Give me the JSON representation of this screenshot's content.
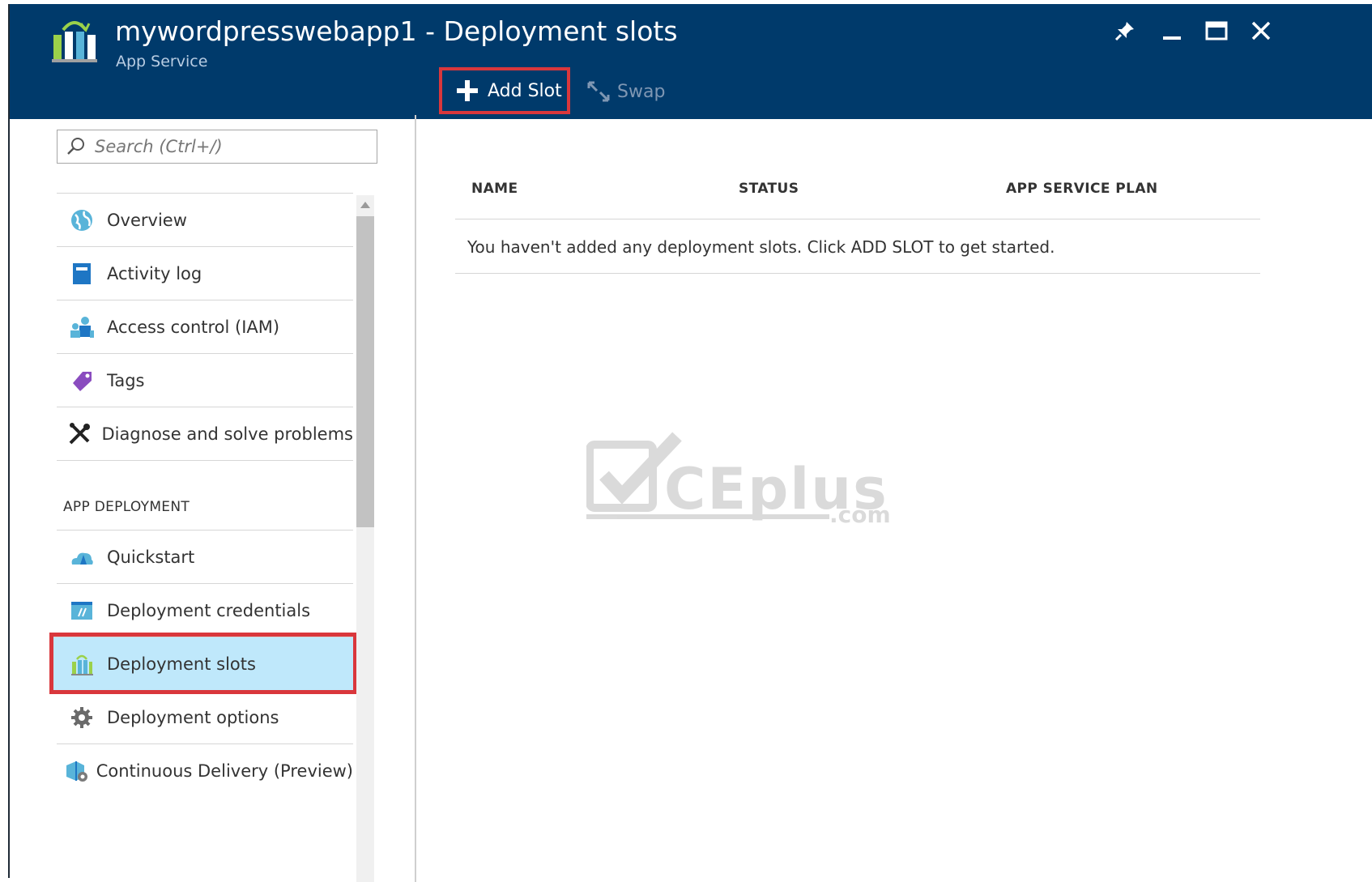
{
  "header": {
    "title": "mywordpresswebapp1 - Deployment slots",
    "subtitle": "App Service",
    "commands": {
      "add_slot": "Add Slot",
      "swap": "Swap"
    },
    "window_controls": [
      "pin-icon",
      "minimize-icon",
      "maximize-icon",
      "close-icon"
    ]
  },
  "sidebar": {
    "search_placeholder": "Search (Ctrl+/)",
    "items": [
      {
        "label": "Overview",
        "icon": "overview-globe-icon"
      },
      {
        "label": "Activity log",
        "icon": "activity-log-icon"
      },
      {
        "label": "Access control (IAM)",
        "icon": "access-control-icon"
      },
      {
        "label": "Tags",
        "icon": "tag-icon"
      },
      {
        "label": "Diagnose and solve problems",
        "icon": "tools-icon"
      }
    ],
    "section_title": "APP DEPLOYMENT",
    "section_items": [
      {
        "label": "Quickstart",
        "icon": "quickstart-cloud-icon"
      },
      {
        "label": "Deployment credentials",
        "icon": "credentials-icon"
      },
      {
        "label": "Deployment slots",
        "icon": "deployment-slots-icon",
        "selected": true
      },
      {
        "label": "Deployment options",
        "icon": "gear-icon"
      },
      {
        "label": "Continuous Delivery (Preview)",
        "icon": "continuous-delivery-icon"
      }
    ]
  },
  "table": {
    "columns": [
      "NAME",
      "STATUS",
      "APP SERVICE PLAN"
    ],
    "empty_message": "You haven't added any deployment slots. Click ADD SLOT to get started."
  },
  "watermark": {
    "text": "CEplus",
    "suffix": ".com"
  },
  "colors": {
    "header_bg": "#003a6b",
    "highlight_red": "#d9373c",
    "selected_bg": "#bfe8fb"
  }
}
